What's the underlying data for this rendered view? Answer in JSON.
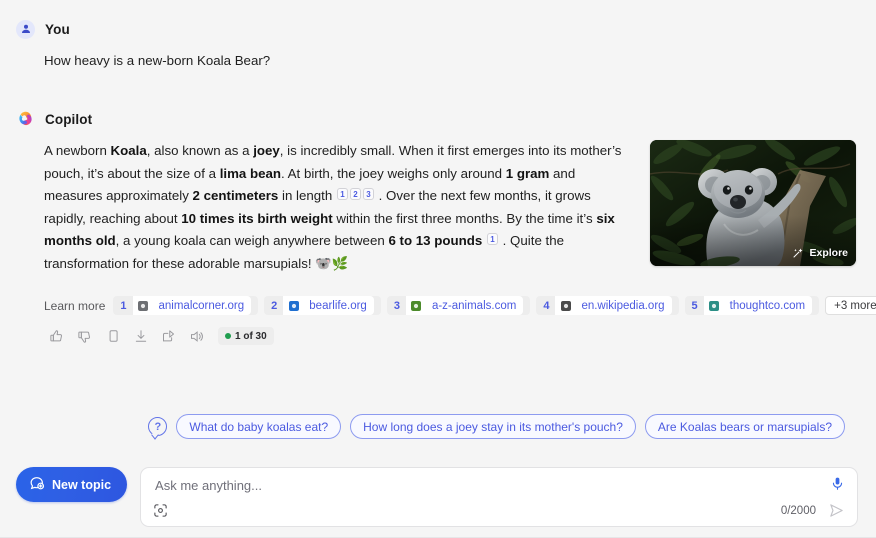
{
  "user": {
    "author": "You",
    "avatar_icon": "person-avatar-icon",
    "message": "How heavy is a new-born Koala Bear?"
  },
  "assistant": {
    "author": "Copilot",
    "avatar_icon": "copilot-logo-icon",
    "answer_segments": [
      {
        "t": "A newborn ",
        "b": false
      },
      {
        "t": "Koala",
        "b": true
      },
      {
        "t": ", also known as a ",
        "b": false
      },
      {
        "t": "joey",
        "b": true
      },
      {
        "t": ", is incredibly small. When it first emerges into its mother’s pouch, it’s about the size of a ",
        "b": false
      },
      {
        "t": "lima bean",
        "b": true
      },
      {
        "t": ". At birth, the joey weighs only around ",
        "b": false
      },
      {
        "t": "1 gram",
        "b": true
      },
      {
        "t": " and measures approximately ",
        "b": false
      },
      {
        "t": "2 centimeters",
        "b": true
      },
      {
        "t": " in length ",
        "b": false
      },
      {
        "sup": "1"
      },
      {
        "sup": "2"
      },
      {
        "sup": "3"
      },
      {
        "t": " . Over the next few months, it grows rapidly, reaching about ",
        "b": false
      },
      {
        "t": "10 times its birth weight",
        "b": true
      },
      {
        "t": " within the first three months. By the time it’s ",
        "b": false
      },
      {
        "t": "six months old",
        "b": true
      },
      {
        "t": ", a young koala can weigh anywhere between ",
        "b": false
      },
      {
        "t": "6 to 13 pounds",
        "b": true
      },
      {
        "t": " ",
        "b": false
      },
      {
        "sup": "1"
      },
      {
        "t": " . Quite the transformation for these adorable marsupials! 🐨🌿",
        "b": false
      }
    ],
    "hero_image": {
      "alt": "Koala sitting in a eucalyptus tree",
      "explore_label": "Explore",
      "explore_icon": "sparkle-wand-icon"
    },
    "learn_more_label": "Learn more",
    "citations": [
      {
        "num": "1",
        "domain": "animalcorner.org",
        "favicon": "animalcorner-favicon"
      },
      {
        "num": "2",
        "domain": "bearlife.org",
        "favicon": "bearlife-favicon"
      },
      {
        "num": "3",
        "domain": "a-z-animals.com",
        "favicon": "a-z-animals-favicon"
      },
      {
        "num": "4",
        "domain": "en.wikipedia.org",
        "favicon": "wikipedia-favicon"
      },
      {
        "num": "5",
        "domain": "thoughtco.com",
        "favicon": "thoughtco-favicon"
      }
    ],
    "more_citations_label": "+3 more",
    "actions": [
      {
        "name": "thumbs-up-icon",
        "title": "Like"
      },
      {
        "name": "thumbs-down-icon",
        "title": "Dislike"
      },
      {
        "name": "copy-icon",
        "title": "Copy"
      },
      {
        "name": "download-icon",
        "title": "Export"
      },
      {
        "name": "share-icon",
        "title": "Share"
      },
      {
        "name": "speaker-icon",
        "title": "Read aloud"
      }
    ],
    "turn_counter": "1 of 30",
    "turn_counter_dot_color": "#1f9d4e"
  },
  "suggestions": {
    "icon": "question-bubble-icon",
    "items": [
      "What do baby koalas eat?",
      "How long does a joey stay in its mother's pouch?",
      "Are Koalas bears or marsupials?"
    ]
  },
  "composer": {
    "new_topic_label": "New topic",
    "new_topic_icon": "new-chat-plus-icon",
    "placeholder": "Ask me anything...",
    "char_counter": "0/2000",
    "mic_icon": "microphone-icon",
    "send_icon": "send-arrow-icon",
    "camera_icon": "visual-search-icon"
  },
  "theme": {
    "background": "#f5f5f5",
    "accent_blue": "#4b5ae0",
    "brand_blue": "#2a63e8",
    "text": "#1f1f1f"
  }
}
